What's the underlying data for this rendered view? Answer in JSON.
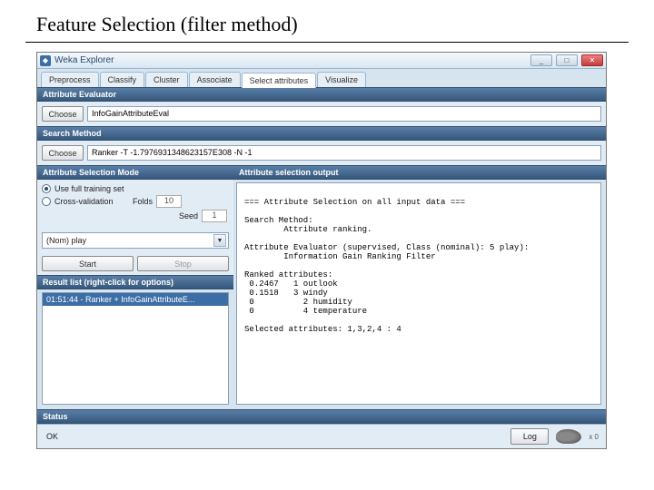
{
  "slide": {
    "title": "Feature Selection (filter method)"
  },
  "window": {
    "title": "Weka Explorer",
    "min": "_",
    "max": "□",
    "close": "✕"
  },
  "tabs": {
    "items": [
      "Preprocess",
      "Classify",
      "Cluster",
      "Associate",
      "Select attributes",
      "Visualize"
    ],
    "activeIndex": 4
  },
  "evaluator": {
    "header": "Attribute Evaluator",
    "choose": "Choose",
    "value": "InfoGainAttributeEval"
  },
  "search": {
    "header": "Search Method",
    "choose": "Choose",
    "value": "Ranker -T -1.7976931348623157E308 -N -1"
  },
  "mode": {
    "header": "Attribute Selection Mode",
    "opt1": "Use full training set",
    "opt2": "Cross-validation",
    "folds_label": "Folds",
    "folds_val": "10",
    "seed_label": "Seed",
    "seed_val": "1"
  },
  "class_selector": {
    "value": "(Nom) play",
    "arrow": "▼"
  },
  "buttons": {
    "start": "Start",
    "stop": "Stop"
  },
  "resultlist": {
    "header": "Result list (right-click for options)",
    "item": "01:51:44 - Ranker + InfoGainAttributeE..."
  },
  "output_header": "Attribute selection output",
  "output_lines": [
    "",
    "=== Attribute Selection on all input data ===",
    "",
    "Search Method:",
    "        Attribute ranking.",
    "",
    "Attribute Evaluator (supervised, Class (nominal): 5 play):",
    "        Information Gain Ranking Filter",
    "",
    "Ranked attributes:",
    " 0.2467   1 outlook",
    " 0.1518   3 windy",
    " 0          2 humidity",
    " 0          4 temperature",
    "",
    "Selected attributes: 1,3,2,4 : 4"
  ],
  "status": {
    "header": "Status",
    "text": "OK",
    "log": "Log",
    "count": "x 0"
  }
}
